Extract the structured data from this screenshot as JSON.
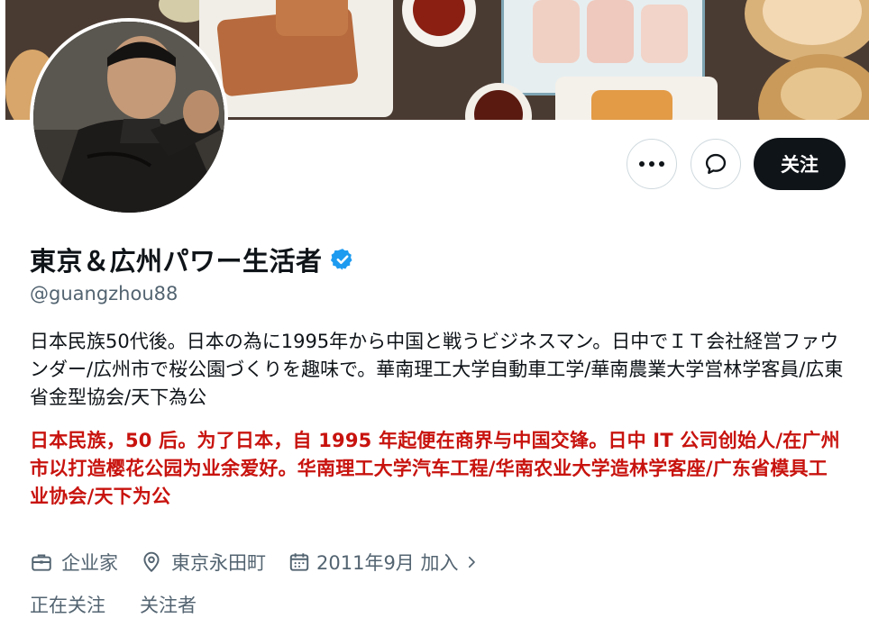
{
  "header": {
    "banner_alt": "dim sum food photo banner"
  },
  "actions": {
    "more_icon": "more-horizontal-icon",
    "message_icon": "message-bubble-icon",
    "follow_label": "关注"
  },
  "profile": {
    "display_name": "東京＆広州パワー生活者",
    "verified_icon": "verified-badge-icon",
    "verified_color": "#1d9bf0",
    "handle": "@guangzhou88",
    "bio": "日本民族50代後。日本の為に1995年から中国と戦うビジネスマン。日中でＩＴ会社経営ファウンダー/広州市で桜公園づくりを趣味で。華南理工大学自動車工学/華南農業大学営林学客員/広東省金型協会/天下為公",
    "bio_translation": "日本民族，50 后。为了日本，自 1995 年起便在商界与中国交锋。日中 IT 公司创始人/在广州市以打造樱花公园为业余爱好。华南理工大学汽车工程/华南农业大学造林学客座/广东省模具工业协会/天下为公",
    "translation_color": "#c8130e"
  },
  "meta": {
    "profession": "企业家",
    "profession_icon": "briefcase-icon",
    "location": "東京永田町",
    "location_icon": "location-pin-icon",
    "joined": "2011年9月 加入",
    "joined_icon": "calendar-icon",
    "joined_chevron_icon": "chevron-right-icon"
  },
  "counts": {
    "following_label": "正在关注",
    "followers_label": "关注者"
  }
}
